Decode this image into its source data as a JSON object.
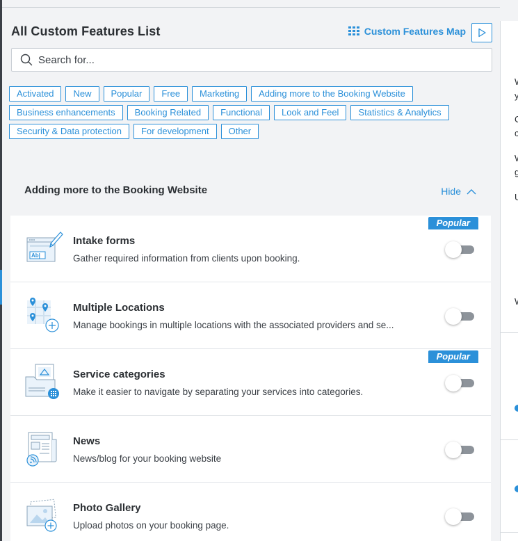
{
  "header": {
    "title": "All Custom Features List",
    "map_link_label": "Custom Features Map"
  },
  "search": {
    "placeholder": "Search for..."
  },
  "tags": [
    "Activated",
    "New",
    "Popular",
    "Free",
    "Marketing",
    "Adding more to the Booking Website",
    "Business enhancements",
    "Booking Related",
    "Functional",
    "Look and Feel",
    "Statistics & Analytics",
    "Security & Data protection",
    "For development",
    "Other"
  ],
  "section": {
    "title": "Adding more to the Booking Website",
    "hide_label": "Hide"
  },
  "features": [
    {
      "name": "Intake forms",
      "description": "Gather required information from clients upon booking.",
      "badge": "Popular",
      "enabled": false,
      "icon": "intake-form-icon"
    },
    {
      "name": "Multiple Locations",
      "description": "Manage bookings in multiple locations with the associated providers and se...",
      "badge": "",
      "enabled": false,
      "icon": "locations-icon"
    },
    {
      "name": "Service categories",
      "description": "Make it easier to navigate by separating your services into categories.",
      "badge": "Popular",
      "enabled": false,
      "icon": "service-categories-icon"
    },
    {
      "name": "News",
      "description": "News/blog for your booking website",
      "badge": "",
      "enabled": false,
      "icon": "news-icon"
    },
    {
      "name": "Photo Gallery",
      "description": "Upload photos on your booking page.",
      "badge": "",
      "enabled": false,
      "icon": "photo-gallery-icon"
    }
  ],
  "right_panel": {
    "lines": [
      "W",
      "y",
      "C",
      "c",
      "W",
      "g",
      "U",
      "W"
    ]
  },
  "colors": {
    "accent": "#2b90d9",
    "background": "#f2f3f5",
    "toggle_off": "#8d939a"
  }
}
